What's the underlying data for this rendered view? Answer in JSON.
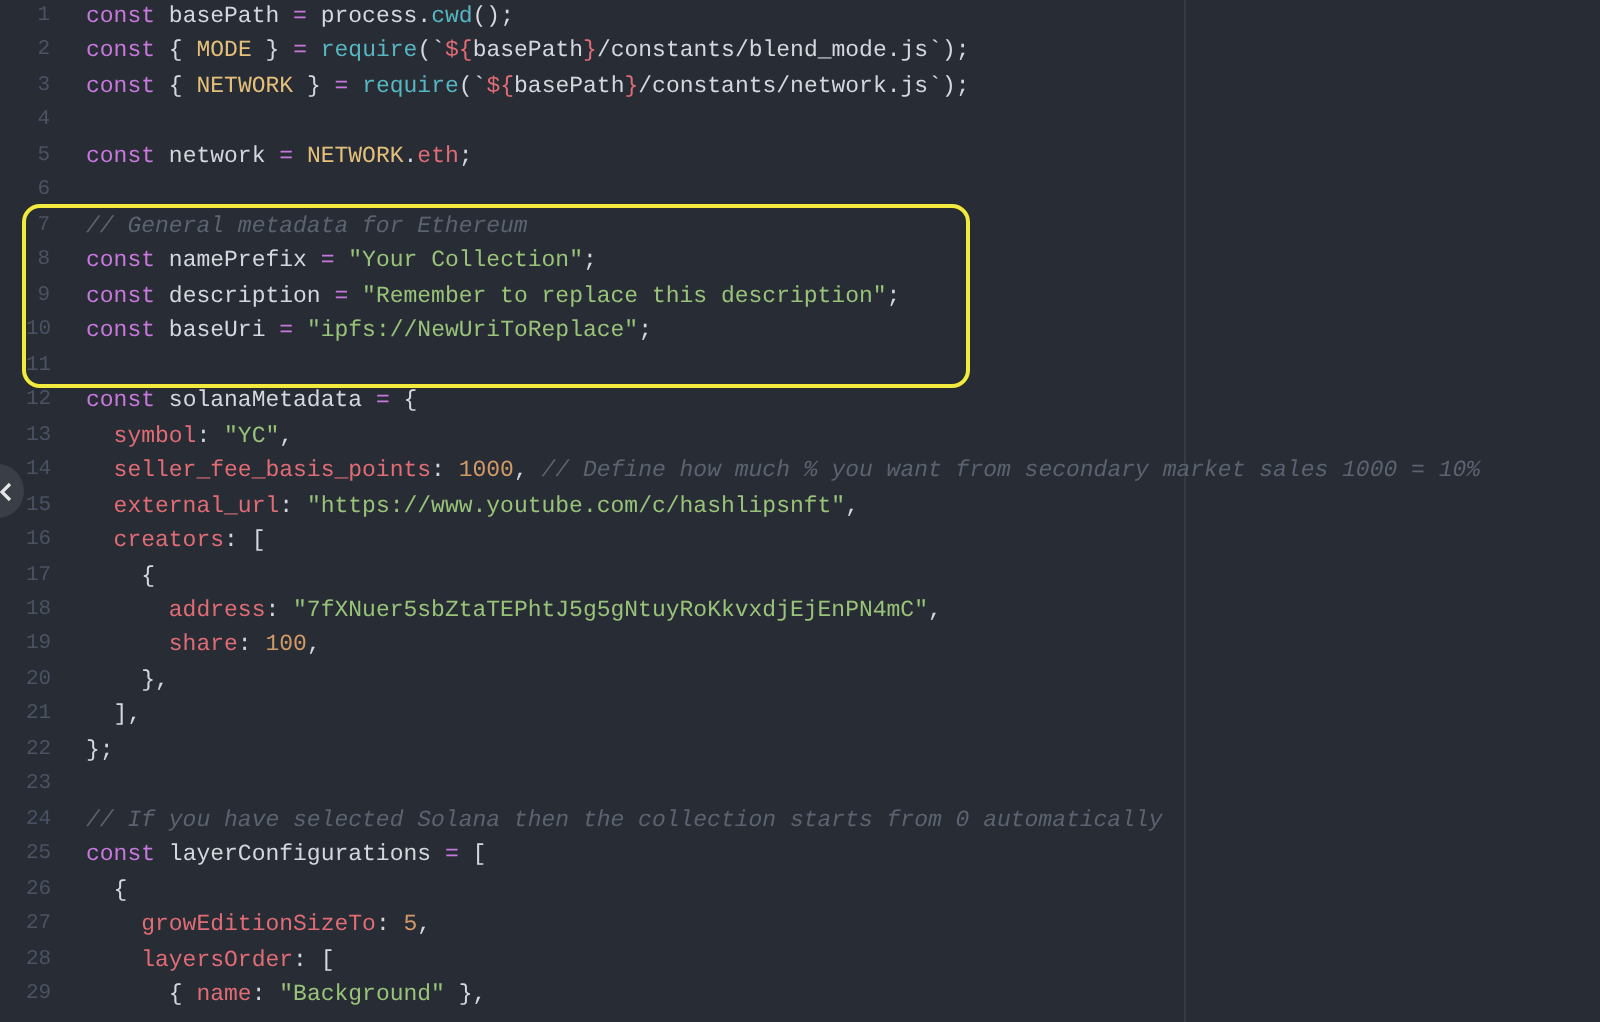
{
  "editor": {
    "lines": [
      {
        "number": "1",
        "tokens": [
          {
            "kind": "keyword",
            "text": "const"
          },
          {
            "kind": "plain",
            "text": " basePath "
          },
          {
            "kind": "operator",
            "text": "="
          },
          {
            "kind": "plain",
            "text": " process."
          },
          {
            "kind": "function",
            "text": "cwd"
          },
          {
            "kind": "plain",
            "text": "();"
          }
        ]
      },
      {
        "number": "2",
        "tokens": [
          {
            "kind": "keyword",
            "text": "const"
          },
          {
            "kind": "plain",
            "text": " { "
          },
          {
            "kind": "constant",
            "text": "MODE"
          },
          {
            "kind": "plain",
            "text": " } "
          },
          {
            "kind": "operator",
            "text": "= "
          },
          {
            "kind": "function",
            "text": "require"
          },
          {
            "kind": "plain",
            "text": "(`"
          },
          {
            "kind": "template",
            "text": "${"
          },
          {
            "kind": "plain",
            "text": "basePath"
          },
          {
            "kind": "template",
            "text": "}"
          },
          {
            "kind": "plain",
            "text": "/constants/blend_mode.js`);"
          }
        ]
      },
      {
        "number": "3",
        "tokens": [
          {
            "kind": "keyword",
            "text": "const"
          },
          {
            "kind": "plain",
            "text": " { "
          },
          {
            "kind": "constant",
            "text": "NETWORK"
          },
          {
            "kind": "plain",
            "text": " } "
          },
          {
            "kind": "operator",
            "text": "= "
          },
          {
            "kind": "function",
            "text": "require"
          },
          {
            "kind": "plain",
            "text": "(`"
          },
          {
            "kind": "template",
            "text": "${"
          },
          {
            "kind": "plain",
            "text": "basePath"
          },
          {
            "kind": "template",
            "text": "}"
          },
          {
            "kind": "plain",
            "text": "/constants/network.js`);"
          }
        ]
      },
      {
        "number": "4"
      },
      {
        "number": "5",
        "tokens": [
          {
            "kind": "keyword",
            "text": "const"
          },
          {
            "kind": "plain",
            "text": " network "
          },
          {
            "kind": "operator",
            "text": "= "
          },
          {
            "kind": "constant",
            "text": "NETWORK"
          },
          {
            "kind": "plain",
            "text": "."
          },
          {
            "kind": "property",
            "text": "eth"
          },
          {
            "kind": "plain",
            "text": ";"
          }
        ]
      },
      {
        "number": "6"
      },
      {
        "number": "7",
        "highlighted": true,
        "tokens": [
          {
            "kind": "comment",
            "text": "// General metadata for Ethereum"
          }
        ]
      },
      {
        "number": "8",
        "highlighted": true,
        "tokens": [
          {
            "kind": "keyword",
            "text": "const"
          },
          {
            "kind": "plain",
            "text": " namePrefix "
          },
          {
            "kind": "operator",
            "text": "= "
          },
          {
            "kind": "string",
            "text": "\"Your Collection\""
          },
          {
            "kind": "plain",
            "text": ";"
          }
        ]
      },
      {
        "number": "9",
        "highlighted": true,
        "tokens": [
          {
            "kind": "keyword",
            "text": "const"
          },
          {
            "kind": "plain",
            "text": " description "
          },
          {
            "kind": "operator",
            "text": "= "
          },
          {
            "kind": "string",
            "text": "\"Remember to replace this description\""
          },
          {
            "kind": "plain",
            "text": ";"
          }
        ]
      },
      {
        "number": "10",
        "highlighted": true,
        "tokens": [
          {
            "kind": "keyword",
            "text": "const"
          },
          {
            "kind": "plain",
            "text": " baseUri "
          },
          {
            "kind": "operator",
            "text": "= "
          },
          {
            "kind": "string",
            "text": "\"ipfs://NewUriToReplace\""
          },
          {
            "kind": "plain",
            "text": ";"
          }
        ]
      },
      {
        "number": "11",
        "highlighted": true
      },
      {
        "number": "12",
        "tokens": [
          {
            "kind": "keyword",
            "text": "const"
          },
          {
            "kind": "plain",
            "text": " solanaMetadata "
          },
          {
            "kind": "operator",
            "text": "="
          },
          {
            "kind": "plain",
            "text": " {"
          }
        ]
      },
      {
        "number": "13",
        "tokens": [
          {
            "kind": "property",
            "text": "  symbol"
          },
          {
            "kind": "plain",
            "text": ": "
          },
          {
            "kind": "string",
            "text": "\"YC\""
          },
          {
            "kind": "plain",
            "text": ","
          }
        ]
      },
      {
        "number": "14",
        "tokens": [
          {
            "kind": "property",
            "text": "  seller_fee_basis_points"
          },
          {
            "kind": "plain",
            "text": ": "
          },
          {
            "kind": "number",
            "text": "1000"
          },
          {
            "kind": "plain",
            "text": ", "
          },
          {
            "kind": "comment",
            "text": "// Define how much % you want from secondary market sales 1000 = 10%"
          }
        ]
      },
      {
        "number": "15",
        "tokens": [
          {
            "kind": "property",
            "text": "  external_url"
          },
          {
            "kind": "plain",
            "text": ": "
          },
          {
            "kind": "string",
            "text": "\"https://www.youtube.com/c/hashlipsnft\""
          },
          {
            "kind": "plain",
            "text": ","
          }
        ]
      },
      {
        "number": "16",
        "tokens": [
          {
            "kind": "property",
            "text": "  creators"
          },
          {
            "kind": "plain",
            "text": ": ["
          }
        ]
      },
      {
        "number": "17",
        "tokens": [
          {
            "kind": "plain",
            "text": "    {"
          }
        ]
      },
      {
        "number": "18",
        "tokens": [
          {
            "kind": "property",
            "text": "      address"
          },
          {
            "kind": "plain",
            "text": ": "
          },
          {
            "kind": "string",
            "text": "\"7fXNuer5sbZtaTEPhtJ5g5gNtuyRoKkvxdjEjEnPN4mC\""
          },
          {
            "kind": "plain",
            "text": ","
          }
        ]
      },
      {
        "number": "19",
        "tokens": [
          {
            "kind": "property",
            "text": "      share"
          },
          {
            "kind": "plain",
            "text": ": "
          },
          {
            "kind": "number",
            "text": "100"
          },
          {
            "kind": "plain",
            "text": ","
          }
        ]
      },
      {
        "number": "20",
        "tokens": [
          {
            "kind": "plain",
            "text": "    },"
          }
        ]
      },
      {
        "number": "21",
        "tokens": [
          {
            "kind": "plain",
            "text": "  ],"
          }
        ]
      },
      {
        "number": "22",
        "tokens": [
          {
            "kind": "plain",
            "text": "};"
          }
        ]
      },
      {
        "number": "23"
      },
      {
        "number": "24",
        "tokens": [
          {
            "kind": "comment",
            "text": "// If you have selected Solana then the collection starts from 0 automatically"
          }
        ]
      },
      {
        "number": "25",
        "tokens": [
          {
            "kind": "keyword",
            "text": "const"
          },
          {
            "kind": "plain",
            "text": " layerConfigurations "
          },
          {
            "kind": "operator",
            "text": "="
          },
          {
            "kind": "plain",
            "text": " ["
          }
        ]
      },
      {
        "number": "26",
        "tokens": [
          {
            "kind": "plain",
            "text": "  {"
          }
        ]
      },
      {
        "number": "27",
        "tokens": [
          {
            "kind": "property",
            "text": "    growEditionSizeTo"
          },
          {
            "kind": "plain",
            "text": ": "
          },
          {
            "kind": "number",
            "text": "5"
          },
          {
            "kind": "plain",
            "text": ","
          }
        ]
      },
      {
        "number": "28",
        "tokens": [
          {
            "kind": "property",
            "text": "    layersOrder"
          },
          {
            "kind": "plain",
            "text": ": ["
          }
        ]
      },
      {
        "number": "29",
        "tokens": [
          {
            "kind": "plain",
            "text": "      { "
          },
          {
            "kind": "property",
            "text": "name"
          },
          {
            "kind": "plain",
            "text": ": "
          },
          {
            "kind": "string",
            "text": "\"Background\""
          },
          {
            "kind": "plain",
            "text": " },"
          }
        ]
      }
    ]
  }
}
